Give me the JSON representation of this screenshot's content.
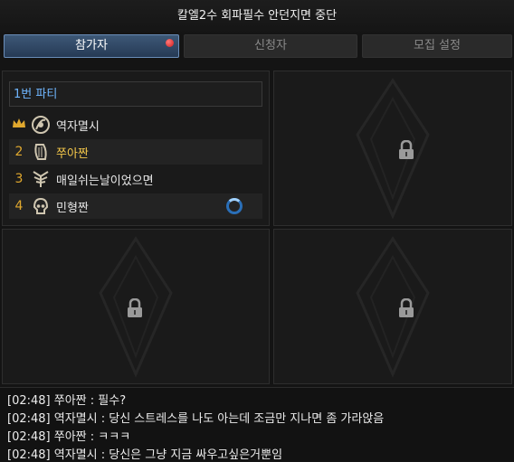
{
  "title": "칼엘2수 회파필수 안던지면 중단",
  "tabs": [
    {
      "label": "참가자",
      "active": true,
      "notification": true
    },
    {
      "label": "신청자",
      "active": false
    },
    {
      "label": "모집 설정",
      "active": false
    }
  ],
  "party": {
    "name": "1번 파티",
    "members": [
      {
        "rank": "leader",
        "rank_icon": "crown-icon",
        "class_icon": "bard-icon",
        "name": "역자멸시",
        "is_self": false,
        "loading": false
      },
      {
        "rank": "2",
        "class_icon": "harp-icon",
        "name": "쭈아짠",
        "is_self": true,
        "loading": false
      },
      {
        "rank": "3",
        "class_icon": "blade-wings-icon",
        "name": "매일쉬는날이었으면",
        "is_self": false,
        "loading": false
      },
      {
        "rank": "4",
        "class_icon": "skull-helm-icon",
        "name": "민형짠",
        "is_self": false,
        "loading": true
      }
    ]
  },
  "locked_slots": [
    "lock-icon",
    "lock-icon",
    "lock-icon"
  ],
  "chat": [
    {
      "time": "[02:48]",
      "speaker": "쭈아짠",
      "message": "필수?"
    },
    {
      "time": "[02:48]",
      "speaker": "역자멸시",
      "message": "당신 스트레스를 나도 아는데 조금만 지나면 좀 가라앉음"
    },
    {
      "time": "[02:48]",
      "speaker": "쭈아짠",
      "message": "ㅋㅋㅋ"
    },
    {
      "time": "[02:48]",
      "speaker": "역자멸시",
      "message": "당신은 그냥 지금 싸우고싶은거뿐임"
    }
  ],
  "colors": {
    "accent": "#6fb6ff",
    "self_name": "#f5c84a",
    "rank_gold": "#e0a82e",
    "notification": "#d11a1a"
  }
}
